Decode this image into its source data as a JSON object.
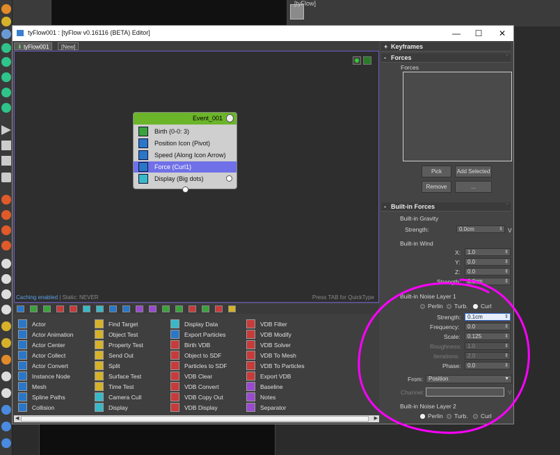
{
  "viewport": {
    "top_right_label": "[tyFlow]"
  },
  "window": {
    "title": "tyFlow001 : [tyFlow v0.16116 (BETA) Editor]",
    "minimize": "—",
    "maximize": "☐",
    "close": "✕"
  },
  "tabs": [
    {
      "label": "tyFlow001"
    },
    {
      "label": "[New]"
    }
  ],
  "graph": {
    "status_prefix": "Caching enabled",
    "status_suffix": " | Static: NEVER",
    "hint": "Press TAB for QuickType",
    "event": {
      "title": "Event_001",
      "operators": [
        {
          "label": "Birth (0-0: 3)"
        },
        {
          "label": "Position Icon (Pivot)"
        },
        {
          "label": "Speed (Along Icon Arrow)"
        },
        {
          "label": "Force (Curl1)"
        },
        {
          "label": "Display (Big dots)"
        }
      ]
    }
  },
  "operator_list": {
    "col1": [
      "Actor",
      "Actor Animation",
      "Actor Center",
      "Actor Collect",
      "Actor Convert",
      "Instance Node",
      "Mesh",
      "Spline Paths",
      "Collision"
    ],
    "col2": [
      "Find Target",
      "Object Test",
      "Property Test",
      "Send Out",
      "Split",
      "Surface Test",
      "Time Test",
      "Camera Cull",
      "Display"
    ],
    "col3": [
      "Display Data",
      "Export Particles",
      "Birth VDB",
      "Object to SDF",
      "Particles to SDF",
      "VDB Clear",
      "VDB Convert",
      "VDB Copy Out",
      "VDB Display"
    ],
    "col4": [
      "VDB Filter",
      "VDB Modify",
      "VDB Solver",
      "VDB To Mesh",
      "VDB To Particles",
      "Export VDB",
      "Baseline",
      "Notes",
      "Separator"
    ]
  },
  "side": {
    "keyframes": {
      "sign": "+",
      "title": "Keyframes"
    },
    "forces": {
      "sign": "-",
      "title": "Forces",
      "list_label": "Forces",
      "pick": "Pick",
      "add_selected": "Add Selected",
      "remove": "Remove",
      "more": "..."
    },
    "builtin": {
      "sign": "-",
      "title": "Built-in Forces",
      "gravity": {
        "label": "Built-in Gravity",
        "strength_label": "Strength:",
        "strength": "0.0cm",
        "v": "V"
      },
      "wind": {
        "label": "Built-in Wind",
        "x_label": "X:",
        "x": "1.0",
        "y_label": "Y:",
        "y": "0.0",
        "z_label": "Z:",
        "z": "0.0",
        "strength_label": "Strength:",
        "strength": "0.0cm"
      },
      "noise1": {
        "label": "Built-in Noise Layer 1",
        "perlin": "Perlin",
        "turb": "Turb.",
        "curl": "Curl",
        "strength_label": "Strength:",
        "strength": "0.1cm",
        "frequency_label": "Frequency:",
        "frequency": "0.0",
        "scale_label": "Scale:",
        "scale": "0.125",
        "roughness_label": "Roughness:",
        "roughness": "1.0",
        "iterations_label": "Iterations:",
        "iterations": "2.0",
        "phase_label": "Phase:",
        "phase": "0.0",
        "from_label": "From:",
        "from": "Position",
        "channel_label": "Channel:",
        "v": "V"
      },
      "noise2": {
        "label": "Built-in Noise Layer 2",
        "perlin": "Perlin",
        "turb": "Turb.",
        "curl": "Curl"
      }
    }
  },
  "colors": {
    "annotation": "#ff00ff",
    "event_header": "#6cb52a",
    "selection": "#7070e8"
  }
}
